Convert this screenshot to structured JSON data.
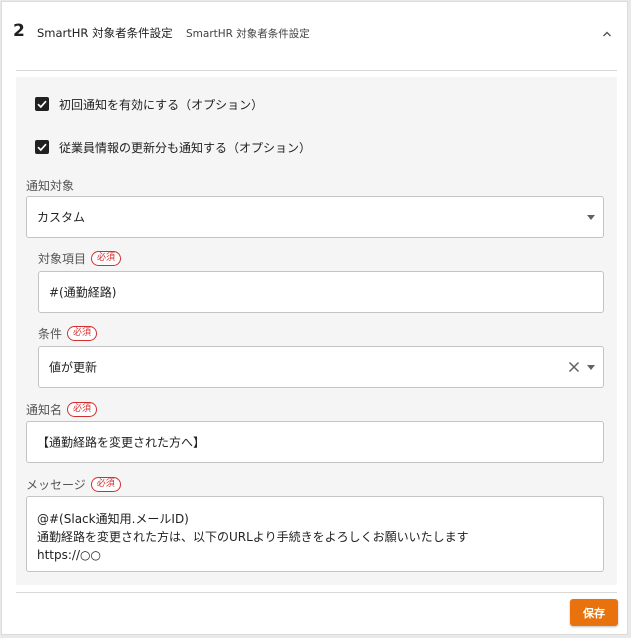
{
  "header": {
    "step": "2",
    "title": "SmartHR 対象者条件設定",
    "subtitle": "SmartHR 対象者条件設定",
    "collapse_icon": "chevron-up-icon"
  },
  "checkboxes": [
    {
      "label": "初回通知を有効にする（オプション）",
      "checked": true
    },
    {
      "label": "従業員情報の更新分も通知する（オプション）",
      "checked": true
    }
  ],
  "notify_target": {
    "label": "通知対象",
    "value": "カスタム"
  },
  "target_item": {
    "label": "対象項目",
    "required": "必須",
    "value": "#(通勤経路)"
  },
  "condition": {
    "label": "条件",
    "required": "必須",
    "value": "値が更新"
  },
  "notify_name": {
    "label": "通知名",
    "required": "必須",
    "value": "【通勤経路を変更された方へ】"
  },
  "message": {
    "label": "メッセージ",
    "required": "必須",
    "lines": [
      "@#(Slack通知用.メールID)",
      "通勤経路を変更された方は、以下のURLより手続きをよろしくお願いいたします",
      "https://○○"
    ]
  },
  "footer": {
    "save_label": "保存"
  },
  "colors": {
    "accent": "#e8730e",
    "required": "#d32f2f"
  }
}
